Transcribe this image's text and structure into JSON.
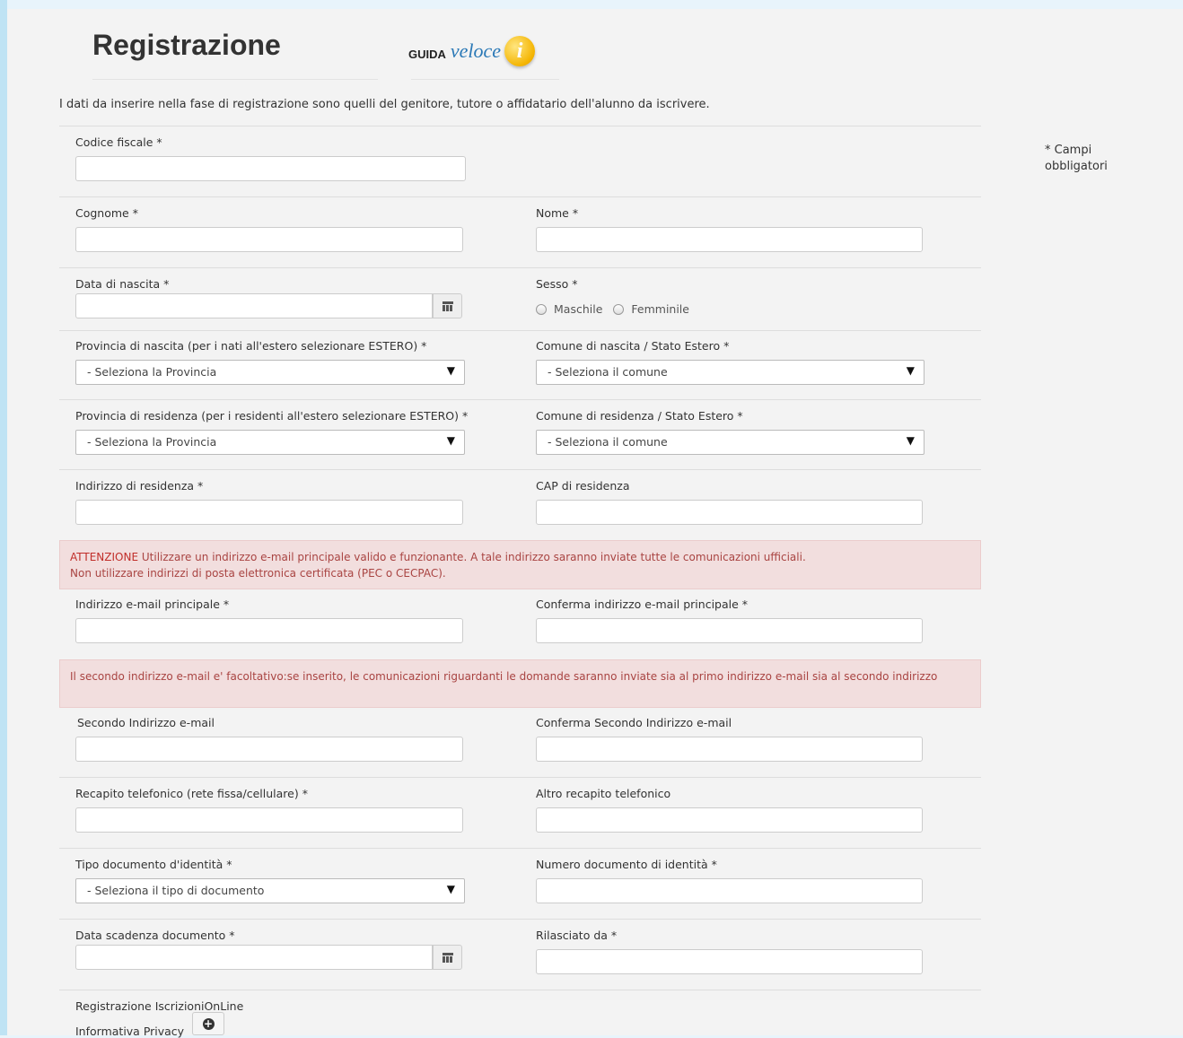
{
  "header": {
    "title": "Registrazione",
    "guida": "GUIDA",
    "veloce": "veloce",
    "info_glyph": "i"
  },
  "intro": "I dati da inserire nella fase di registrazione sono quelli del genitore, tutore o affidatario dell'alunno da iscrivere.",
  "required_note": "* Campi obbligatori",
  "fields": {
    "codice_fiscale": "Codice fiscale *",
    "cognome": "Cognome *",
    "nome": "Nome *",
    "data_nascita": "Data di nascita *",
    "sesso": "Sesso *",
    "maschile": "Maschile",
    "femminile": "Femminile",
    "provincia_nascita": "Provincia di nascita (per i nati all'estero selezionare ESTERO) *",
    "comune_nascita": "Comune di nascita / Stato Estero *",
    "provincia_residenza": "Provincia di residenza (per i residenti all'estero selezionare ESTERO) *",
    "comune_residenza": "Comune di residenza / Stato Estero *",
    "indirizzo_residenza": "Indirizzo di residenza *",
    "cap_residenza": "CAP di residenza",
    "email_principale": "Indirizzo e-mail principale *",
    "conferma_email_principale": "Conferma indirizzo e-mail principale *",
    "secondo_email": "Secondo Indirizzo e-mail",
    "conferma_secondo_email": "Conferma Secondo Indirizzo e-mail",
    "telefono": "Recapito telefonico (rete fissa/cellulare) *",
    "altro_telefono": "Altro recapito telefonico",
    "tipo_documento": "Tipo documento d'identità *",
    "numero_documento": "Numero documento di identità *",
    "data_scadenza": "Data scadenza documento *",
    "rilasciato_da": "Rilasciato da *"
  },
  "selects": {
    "provincia": "- Seleziona la Provincia",
    "comune": "- Seleziona il comune",
    "tipo_documento": "- Seleziona il tipo di documento",
    "arrow": "▼"
  },
  "alerts": {
    "attenzione_strong": "ATTENZIONE",
    "attenzione_text": " Utilizzare un indirizzo e-mail principale valido e funzionante. A tale indirizzo saranno inviate tutte le comunicazioni ufficiali.",
    "attenzione_line2": "Non utilizzare indirizzi di posta elettronica certificata (PEC o CECPAC).",
    "secondo_email_note": "Il secondo indirizzo e-mail e' facoltativo:se inserito, le comunicazioni riguardanti le domande saranno inviate sia al primo indirizzo e-mail sia al secondo indirizzo"
  },
  "footer": {
    "section_title": "Registrazione IscrizioniOnLine",
    "privacy_label": "Informativa Privacy",
    "plus_glyph": "+"
  }
}
